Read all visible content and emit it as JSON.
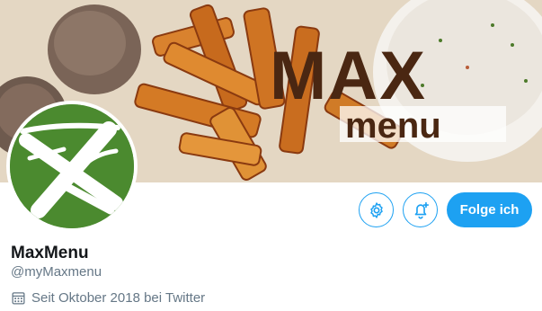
{
  "banner": {
    "brand_top": "MAX",
    "brand_bottom": "menu",
    "brand_color": "#4a2712"
  },
  "profile": {
    "display_name": "MaxMenu",
    "handle": "@myMaxmenu",
    "joined": "Seit Oktober 2018 bei Twitter",
    "avatar_color": "#4b8a2f"
  },
  "actions": {
    "settings_icon": "gear-icon",
    "notify_icon": "bell-plus-icon",
    "follow_label": "Folge ich",
    "accent": "#1da1f2"
  }
}
